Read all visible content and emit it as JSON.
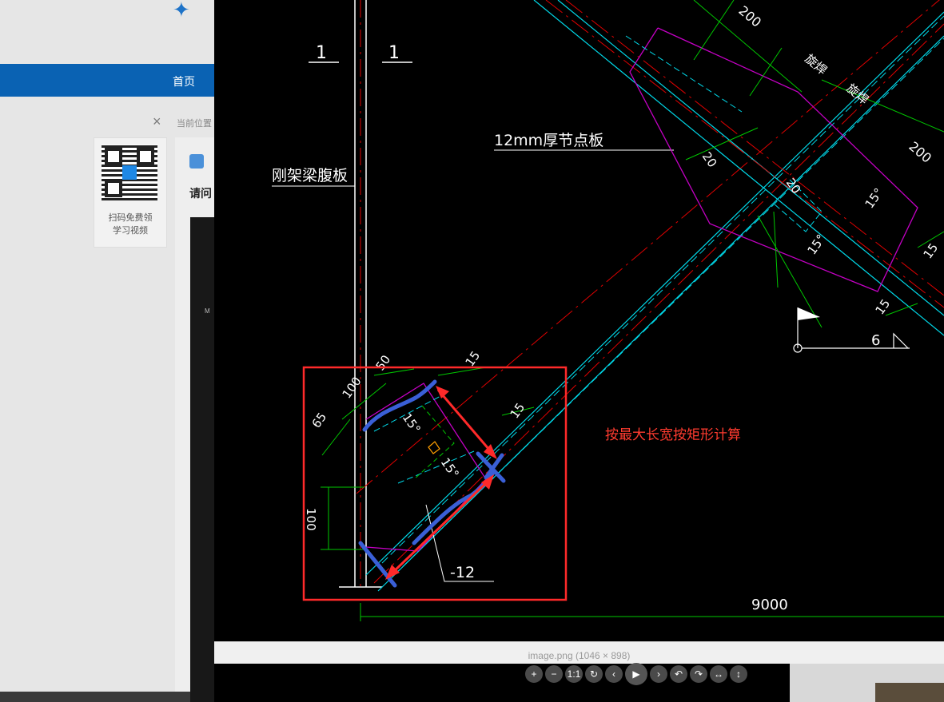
{
  "background_page": {
    "nav_home": "首页",
    "close_symbol": "×",
    "breadcrumb": "当前位置",
    "qr_caption_line1": "扫码免费领",
    "qr_caption_line2": "学习视频",
    "question_prefix": "请问",
    "mini_text": "M"
  },
  "viewer": {
    "status_text": "image.png (1046 × 898)",
    "annotation_text": "按最大长宽按矩形计算",
    "toolbar": [
      "+",
      "−",
      "1:1",
      "↻",
      "‹",
      "▶",
      "›",
      "↶",
      "↷",
      "↔",
      "↕"
    ]
  },
  "drawing": {
    "label_1_left": "1",
    "label_1_right": "1",
    "label_web_plate": "刚架梁腹板",
    "label_gusset": "12mm厚节点板",
    "dim_200_top": "200",
    "dim_200_right": "200",
    "dim_20_a": "20",
    "dim_20_b": "20",
    "dim_15_deg_a": "15°",
    "dim_15_deg_b": "15°",
    "dim_15_a": "15",
    "dim_15_b": "15",
    "dim_15_c": "15",
    "dim_15_d": "15",
    "weld_a": "旋焊",
    "weld_b": "旋焊",
    "elev_label": "6",
    "dim_50": "50",
    "dim_100": "100",
    "dim_65": "65",
    "dim_100_vert": "100",
    "dim_15_box": "15",
    "dim_15_box2": "15",
    "deg_box_a": "15°",
    "deg_box_b": "15°",
    "plate_thk": "-12",
    "dim_9000": "9000"
  },
  "colors": {
    "annotation": "#ff3b2f",
    "cyan": "#00d8e8",
    "magenta": "#c400c4",
    "green": "#00c800",
    "red_line": "#e00000",
    "blue_mark": "#3a5fd6",
    "nav_blue": "#0a62b3"
  }
}
